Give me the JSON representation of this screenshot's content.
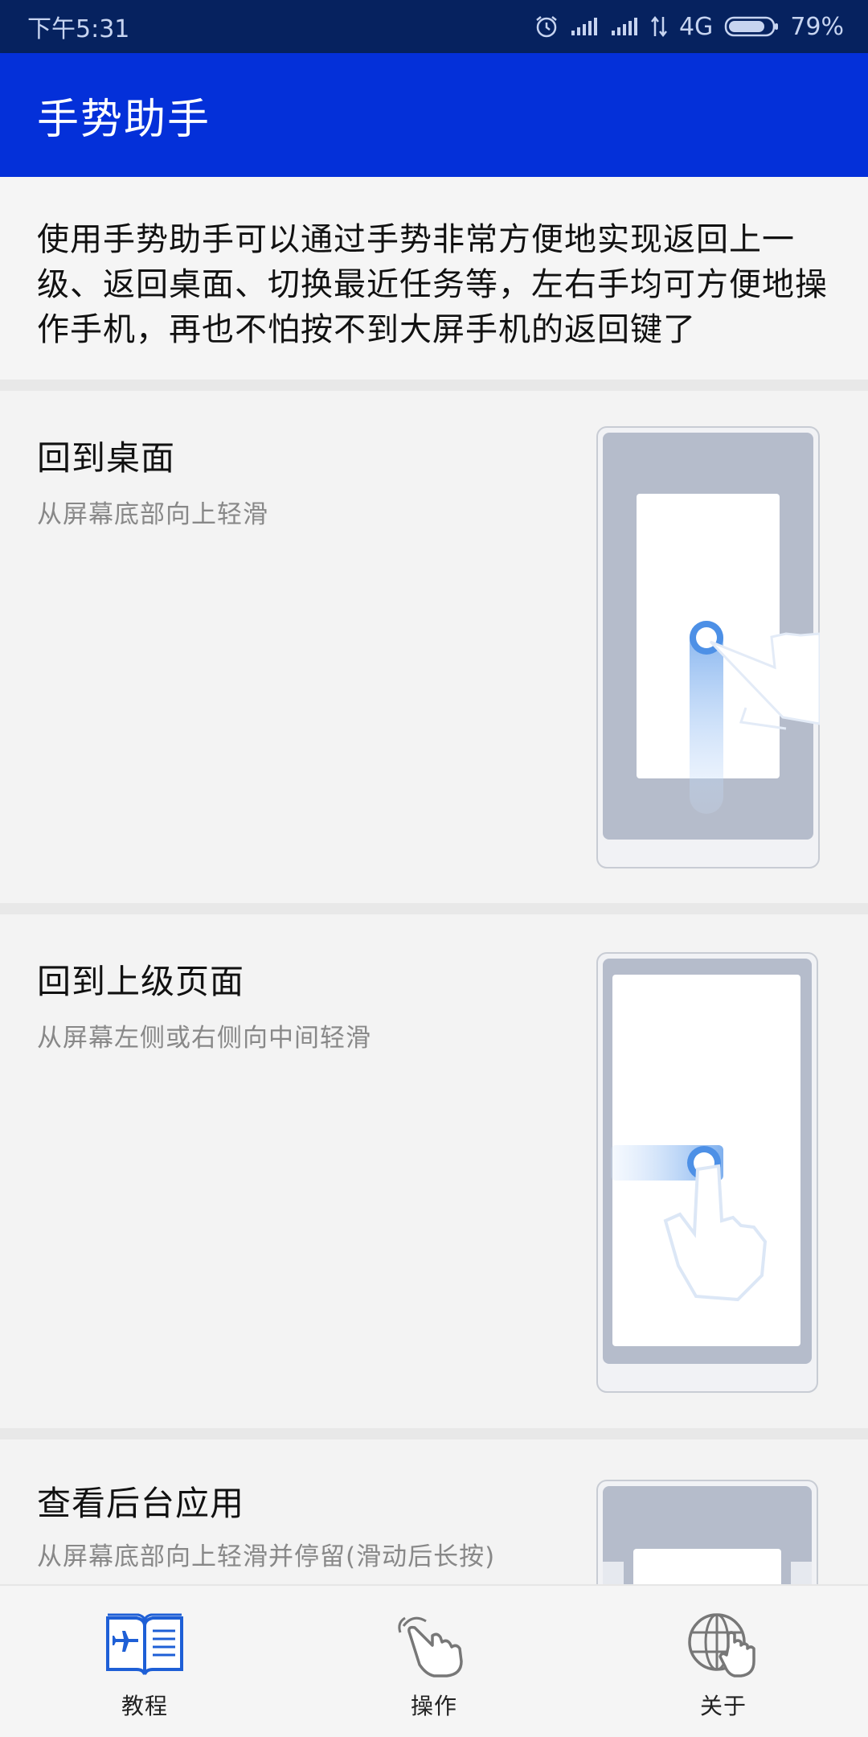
{
  "status": {
    "time": "下午5:31",
    "network": "4G",
    "battery": "79%"
  },
  "app": {
    "title": "手势助手"
  },
  "intro": {
    "text": "使用手势助手可以通过手势非常方便地实现返回上一级、返回桌面、切换最近任务等，左右手均可方便地操作手机，再也不怕按不到大屏手机的返回键了"
  },
  "cards": [
    {
      "title": "回到桌面",
      "desc": "从屏幕底部向上轻滑",
      "illustration": "swipe-up-phone-illustration"
    },
    {
      "title": "回到上级页面",
      "desc": "从屏幕左侧或右侧向中间轻滑",
      "illustration": "swipe-side-phone-illustration"
    },
    {
      "title": "查看后台应用",
      "desc": "从屏幕底部向上轻滑并停留(滑动后长按)",
      "illustration": "recent-apps-phone-illustration"
    }
  ],
  "nav": [
    {
      "label": "教程",
      "icon": "tutorial-book-icon",
      "active": true
    },
    {
      "label": "操作",
      "icon": "gesture-hand-icon",
      "active": false
    },
    {
      "label": "关于",
      "icon": "globe-hand-icon",
      "active": false
    }
  ],
  "colors": {
    "status_bar": "#06225f",
    "app_bar": "#0430d9",
    "accent": "#1e5fd6",
    "background": "#f3f3f3"
  }
}
